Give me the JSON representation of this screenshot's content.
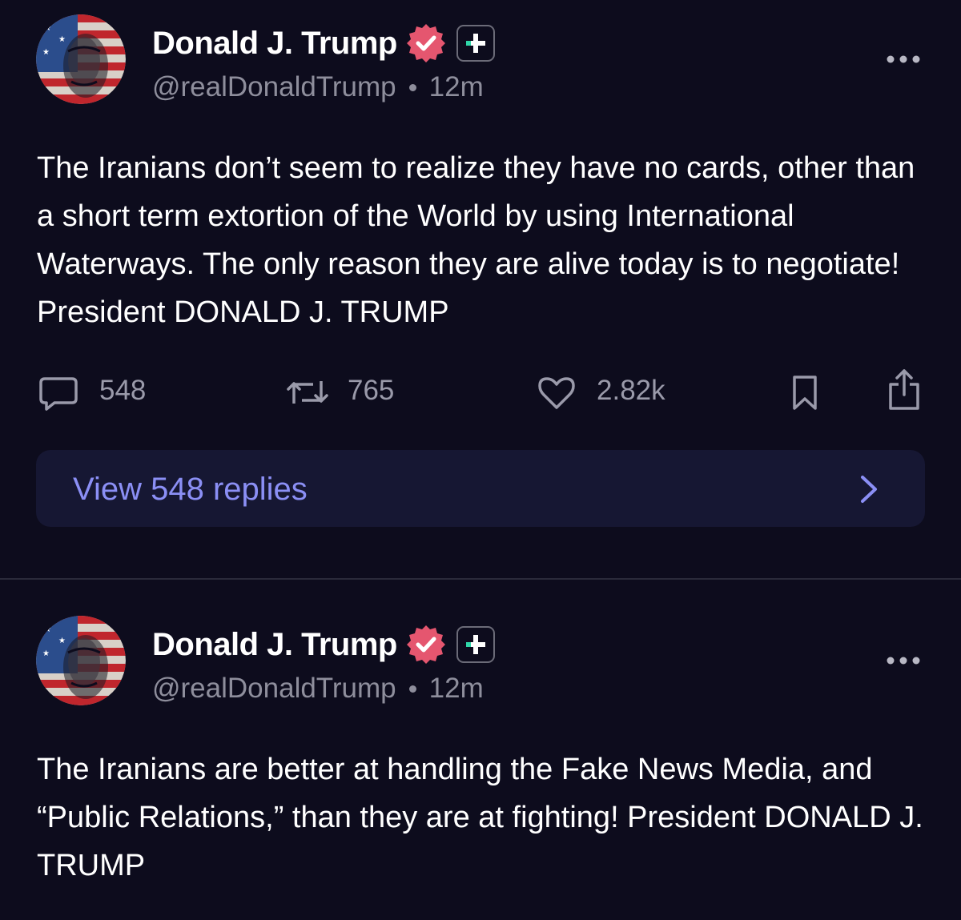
{
  "colors": {
    "background": "#0d0c1d",
    "verified_badge": "#e5566f",
    "link_accent": "#8b8ff5",
    "muted_text": "#8e8e9c"
  },
  "posts": [
    {
      "author": {
        "name": "Donald J. Trump",
        "handle": "@realDonaldTrump",
        "time": "12m",
        "verified_icon": "verified-check-icon",
        "plus_icon": "plus-badge-icon"
      },
      "text": "The Iranians don’t seem to realize they have no cards, other than a short term extortion of the World by using International Waterways. The only reason they are alive today is to negotiate! President DONALD J. TRUMP",
      "stats": {
        "replies": "548",
        "reposts": "765",
        "likes": "2.82k"
      },
      "view_replies_label": "View 548 replies"
    },
    {
      "author": {
        "name": "Donald J. Trump",
        "handle": "@realDonaldTrump",
        "time": "12m",
        "verified_icon": "verified-check-icon",
        "plus_icon": "plus-badge-icon"
      },
      "text": "The Iranians are better at handling the Fake News Media, and “Public Relations,” than they are at fighting! President DONALD J. TRUMP"
    }
  ]
}
